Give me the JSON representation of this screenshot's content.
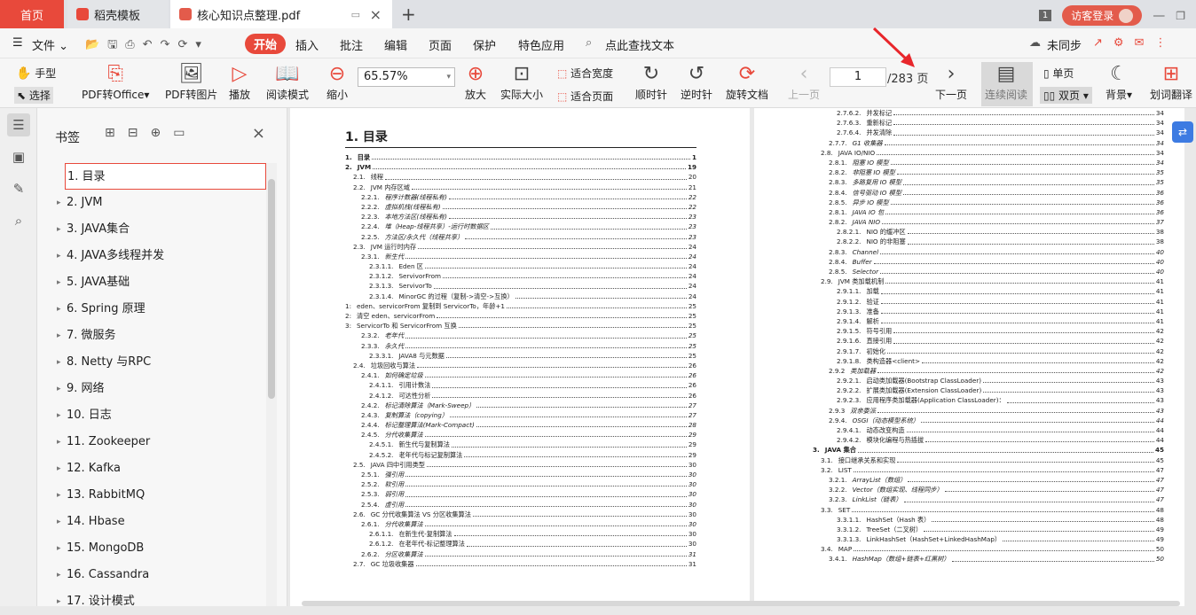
{
  "tabs": {
    "home": "首页",
    "template": "稻壳模板",
    "doc": "核心知识点整理.pdf"
  },
  "top_right": {
    "badge": "1",
    "login": "访客登录"
  },
  "menu": [
    "文件",
    "开始",
    "插入",
    "批注",
    "编辑",
    "页面",
    "保护",
    "特色应用",
    "点此查找文本",
    "未同步"
  ],
  "toolbar": {
    "hand": "手型",
    "select": "选择",
    "pdf_to_office": "PDF转Office",
    "pdf_to_img": "PDF转图片",
    "play": "播放",
    "read_mode": "阅读模式",
    "zoom_out": "缩小",
    "zoom_value": "65.57%",
    "zoom_in": "放大",
    "actual_size": "实际大小",
    "fit_width": "适合宽度",
    "fit_page": "适合页面",
    "clockwise": "顺时针",
    "counter": "逆时针",
    "rotate": "旋转文档",
    "prev": "上一页",
    "page": "1",
    "total": "/283 页",
    "next": "下一页",
    "continuous": "连续阅读",
    "single": "单页",
    "double": "双页",
    "background": "背景",
    "translate": "划词翻译"
  },
  "bookmarks": {
    "title": "书签",
    "items": [
      "1. 目录",
      "2. JVM",
      "3. JAVA集合",
      "4. JAVA多线程并发",
      "5. JAVA基础",
      "6. Spring 原理",
      "7.   微服务",
      "8. Netty 与RPC",
      "9. 网络",
      "10. 日志",
      "11. Zookeeper",
      "12. Kafka",
      "13. RabbitMQ",
      "14. Hbase",
      "15. MongoDB",
      "16. Cassandra",
      "17. 设计模式"
    ]
  },
  "page1": {
    "title": "1. 目录",
    "rows": [
      [
        "1.",
        "目录",
        "1",
        "b"
      ],
      [
        "2.",
        "JVM",
        "19",
        "b"
      ],
      [
        "2.1.",
        "线程",
        "20",
        ""
      ],
      [
        "2.2.",
        "JVM 内存区域",
        "21",
        ""
      ],
      [
        "2.2.1.",
        "程序计数器(线程私有)",
        "22",
        "i"
      ],
      [
        "2.2.2.",
        "虚拟机栈(线程私有)",
        "22",
        "i"
      ],
      [
        "2.2.3.",
        "本地方法区(线程私有)",
        "23",
        "i"
      ],
      [
        "2.2.4.",
        "堆（Heap-线程共享）-运行时数据区",
        "23",
        "i"
      ],
      [
        "2.2.5.",
        "方法区/永久代（线程共享）",
        "23",
        "i"
      ],
      [
        "2.3.",
        "JVM 运行时内存",
        "24",
        ""
      ],
      [
        "2.3.1.",
        "新生代",
        "24",
        "i"
      ],
      [
        "2.3.1.1.",
        "Eden 区",
        "24",
        ""
      ],
      [
        "2.3.1.2.",
        "ServivorFrom",
        "24",
        ""
      ],
      [
        "2.3.1.3.",
        "ServivorTo",
        "24",
        ""
      ],
      [
        "2.3.1.4.",
        "MinorGC 的过程（复制->清空->互换）",
        "24",
        ""
      ],
      [
        "1:",
        "eden、servicorFrom 复制到 ServicorTo，年龄+1",
        "25",
        ""
      ],
      [
        "2:",
        "清空 eden、servicorFrom",
        "25",
        ""
      ],
      [
        "3:",
        "ServicorTo 和 ServicorFrom 互换",
        "25",
        ""
      ],
      [
        "2.3.2.",
        "老年代",
        "25",
        "i"
      ],
      [
        "2.3.3.",
        "永久代",
        "25",
        "i"
      ],
      [
        "2.3.3.1.",
        "JAVA8 与元数据",
        "25",
        ""
      ],
      [
        "2.4.",
        "垃圾回收与算法",
        "26",
        ""
      ],
      [
        "2.4.1.",
        "如何确定垃圾",
        "26",
        "i"
      ],
      [
        "2.4.1.1.",
        "引用计数法",
        "26",
        ""
      ],
      [
        "2.4.1.2.",
        "可达性分析",
        "26",
        ""
      ],
      [
        "2.4.2.",
        "标记清除算法（Mark-Sweep）",
        "27",
        "i"
      ],
      [
        "2.4.3.",
        "复制算法（copying）",
        "27",
        "i"
      ],
      [
        "2.4.4.",
        "标记整理算法(Mark-Compact)",
        "28",
        "i"
      ],
      [
        "2.4.5.",
        "分代收集算法",
        "29",
        "i"
      ],
      [
        "2.4.5.1.",
        "新生代与复制算法",
        "29",
        ""
      ],
      [
        "2.4.5.2.",
        "老年代与标记复制算法",
        "29",
        ""
      ],
      [
        "2.5.",
        "JAVA 四中引用类型",
        "30",
        ""
      ],
      [
        "2.5.1.",
        "强引用",
        "30",
        "i"
      ],
      [
        "2.5.2.",
        "软引用",
        "30",
        "i"
      ],
      [
        "2.5.3.",
        "弱引用",
        "30",
        "i"
      ],
      [
        "2.5.4.",
        "虚引用",
        "30",
        "i"
      ],
      [
        "2.6.",
        "GC 分代收集算法 VS 分区收集算法",
        "30",
        ""
      ],
      [
        "2.6.1.",
        "分代收集算法",
        "30",
        "i"
      ],
      [
        "2.6.1.1.",
        "在新生代-复制算法",
        "30",
        ""
      ],
      [
        "2.6.1.2.",
        "在老年代-标记整理算法",
        "30",
        ""
      ],
      [
        "2.6.2.",
        "分区收集算法",
        "31",
        "i"
      ],
      [
        "2.7.",
        "GC 垃圾收集器",
        "31",
        ""
      ]
    ]
  },
  "page2": {
    "rows": [
      [
        "2.7.6.2.",
        "并发标记",
        "34",
        ""
      ],
      [
        "2.7.6.3.",
        "重新标记",
        "34",
        ""
      ],
      [
        "2.7.6.4.",
        "并发清除",
        "34",
        ""
      ],
      [
        "2.7.7.",
        "G1 收集器",
        "34",
        "i"
      ],
      [
        "2.8.",
        "JAVA IO/NIO",
        "34",
        ""
      ],
      [
        "2.8.1.",
        "阻塞 IO 模型",
        "34",
        "i"
      ],
      [
        "2.8.2.",
        "非阻塞 IO 模型",
        "35",
        "i"
      ],
      [
        "2.8.3.",
        "多路复用 IO 模型",
        "35",
        "i"
      ],
      [
        "2.8.4.",
        "信号驱动 IO 模型",
        "36",
        "i"
      ],
      [
        "2.8.5.",
        "异步 IO 模型",
        "36",
        "i"
      ],
      [
        "2.8.1.",
        "JAVA IO 包",
        "36",
        "i"
      ],
      [
        "2.8.2.",
        "JAVA NIO",
        "37",
        "i"
      ],
      [
        "2.8.2.1.",
        "NIO 的缓冲区",
        "38",
        ""
      ],
      [
        "2.8.2.2.",
        "NIO 的非阻塞",
        "38",
        ""
      ],
      [
        "2.8.3.",
        "Channel",
        "40",
        "i"
      ],
      [
        "2.8.4.",
        "Buffer",
        "40",
        "i"
      ],
      [
        "2.8.5.",
        "Selector",
        "40",
        "i"
      ],
      [
        "2.9.",
        "JVM 类加载机制",
        "41",
        ""
      ],
      [
        "2.9.1.1.",
        "加载",
        "41",
        ""
      ],
      [
        "2.9.1.2.",
        "验证",
        "41",
        ""
      ],
      [
        "2.9.1.3.",
        "准备",
        "41",
        ""
      ],
      [
        "2.9.1.4.",
        "解析",
        "41",
        ""
      ],
      [
        "2.9.1.5.",
        "符号引用",
        "42",
        ""
      ],
      [
        "2.9.1.6.",
        "直接引用",
        "42",
        ""
      ],
      [
        "2.9.1.7.",
        "初始化",
        "42",
        ""
      ],
      [
        "2.9.1.8.",
        "类构造器<client>",
        "42",
        ""
      ],
      [
        "2.9.2",
        "类加载器",
        "42",
        "i"
      ],
      [
        "2.9.2.1.",
        "启动类加载器(Bootstrap ClassLoader)",
        "43",
        ""
      ],
      [
        "2.9.2.2.",
        "扩展类加载器(Extension ClassLoader)",
        "43",
        ""
      ],
      [
        "2.9.2.3.",
        "应用程序类加载器(Application ClassLoader)：",
        "43",
        ""
      ],
      [
        "2.9.3",
        "双亲委派",
        "43",
        "i"
      ],
      [
        "2.9.4.",
        "OSGI（动态模型系统）",
        "44",
        "i"
      ],
      [
        "2.9.4.1.",
        "动态改变构造",
        "44",
        ""
      ],
      [
        "2.9.4.2.",
        "模块化编程与热插拔",
        "44",
        ""
      ],
      [
        "3.",
        "JAVA 集合",
        "45",
        "b"
      ],
      [
        "3.1.",
        "接口继承关系和实现",
        "45",
        ""
      ],
      [
        "3.2.",
        "LIST",
        "47",
        ""
      ],
      [
        "3.2.1.",
        "ArrayList（数组）",
        "47",
        "i"
      ],
      [
        "3.2.2.",
        "Vector（数组实现、线程同步）",
        "47",
        "i"
      ],
      [
        "3.2.3.",
        "LinkList（链表）",
        "47",
        "i"
      ],
      [
        "3.3.",
        "SET",
        "48",
        ""
      ],
      [
        "3.3.1.1.",
        "HashSet（Hash 表）",
        "48",
        ""
      ],
      [
        "3.3.1.2.",
        "TreeSet（二叉树）",
        "49",
        ""
      ],
      [
        "3.3.1.3.",
        "LinkHashSet（HashSet+LinkedHashMap）",
        "49",
        ""
      ],
      [
        "3.4.",
        "MAP",
        "50",
        ""
      ],
      [
        "3.4.1.",
        "HashMap（数组+链表+红黑树）",
        "50",
        "i"
      ]
    ]
  }
}
